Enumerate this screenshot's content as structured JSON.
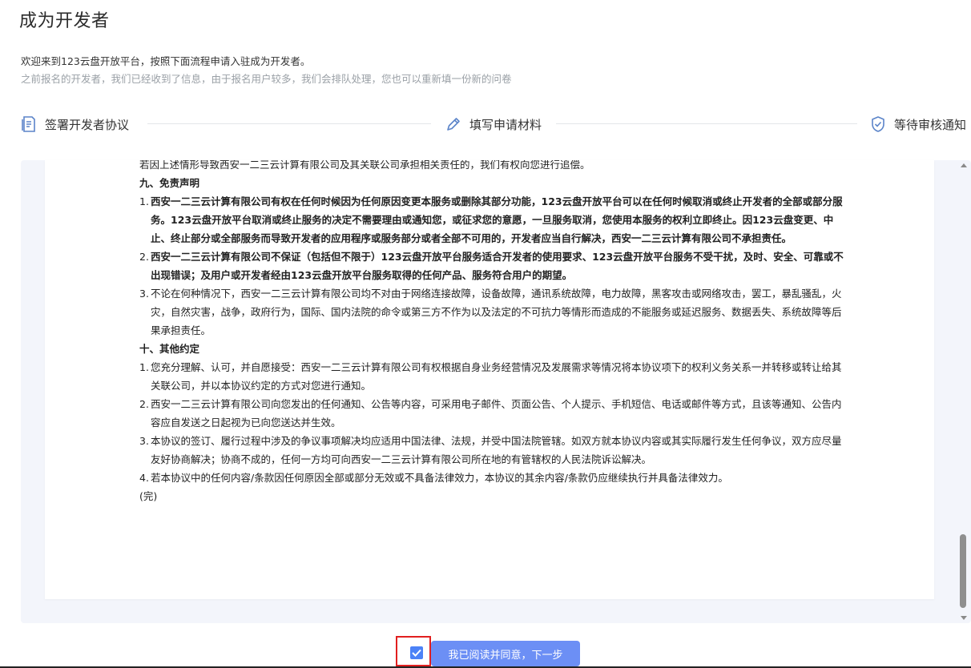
{
  "page": {
    "title": "成为开发者",
    "intro": "欢迎来到123云盘开放平台，按照下面流程申请入驻成为开发者。",
    "notice": "之前报名的开发者，我们已经收到了信息，由于报名用户较多，我们会排队处理，您也可以重新填一份新的问卷"
  },
  "steps": [
    {
      "label": "签署开发者协议",
      "icon": "document-icon"
    },
    {
      "label": "填写申请材料",
      "icon": "pencil-icon"
    },
    {
      "label": "等待审核通知",
      "icon": "shield-check-icon"
    }
  ],
  "agreement": {
    "line_top": "若因上述情形导致西安一二三云计算有限公司及其关联公司承担相关责任的，我们有权向您进行追偿。",
    "section9_title": "九、免责声明",
    "section9": [
      {
        "num": "1.",
        "text": "西安一二三云计算有限公司有权在任何时候因为任何原因变更本服务或删除其部分功能，123云盘开放平台可以在任何时候取消或终止开发者的全部或部分服务。123云盘开放平台取消或终止服务的决定不需要理由或通知您，或征求您的意愿，一旦服务取消，您使用本服务的权利立即终止。因123云盘变更、中止、终止部分或全部服务而导致开发者的应用程序或服务部分或者全部不可用的，开发者应当自行解决，西安一二三云计算有限公司不承担责任。"
      },
      {
        "num": "2.",
        "text": "西安一二三云计算有限公司不保证（包括但不限于）123云盘开放平台服务适合开发者的使用要求、123云盘开放平台服务不受干扰，及时、安全、可靠或不出现错误；及用户或开发者经由123云盘开放平台服务取得的任何产品、服务符合用户的期望。"
      },
      {
        "num": "3.",
        "text": "不论在何种情况下，西安一二三云计算有限公司均不对由于网络连接故障，设备故障，通讯系统故障，电力故障，黑客攻击或网络攻击，罢工，暴乱骚乱，火灾，自然灾害，战争，政府行为，国际、国内法院的命令或第三方不作为以及法定的不可抗力等情形而造成的不能服务或延迟服务、数据丢失、系统故障等后果承担责任。"
      }
    ],
    "section10_title": "十、其他约定",
    "section10": [
      {
        "num": "1.",
        "text": "您充分理解、认可，并自愿接受：西安一二三云计算有限公司有权根据自身业务经营情况及发展需求等情况将本协议项下的权利义务关系一并转移或转让给其关联公司，并以本协议约定的方式对您进行通知。"
      },
      {
        "num": "2.",
        "text": "西安一二三云计算有限公司向您发出的任何通知、公告等内容，可采用电子邮件、页面公告、个人提示、手机短信、电话或邮件等方式，且该等通知、公告内容应自发送之日起视为已向您送达并生效。"
      },
      {
        "num": "3.",
        "text": "本协议的签订、履行过程中涉及的争议事项解决均应适用中国法律、法规，并受中国法院管辖。如双方就本协议内容或其实际履行发生任何争议，双方应尽量友好协商解决；协商不成的，任何一方均可向西安一二三云计算有限公司所在地的有管辖权的人民法院诉讼解决。"
      },
      {
        "num": "4.",
        "text": "若本协议中的任何内容/条款因任何原因全部或部分无效或不具备法律效力，本协议的其余内容/条款仍应继续执行并具备法律效力。"
      }
    ],
    "end": "(完)"
  },
  "action": {
    "agree_checked": true,
    "next_label": "我已阅读并同意，下一步"
  },
  "colors": {
    "primary": "#4c82f7",
    "button": "#6c8ff5",
    "highlight_border": "#e11f1f",
    "panel_bg": "#f3f5fb"
  }
}
